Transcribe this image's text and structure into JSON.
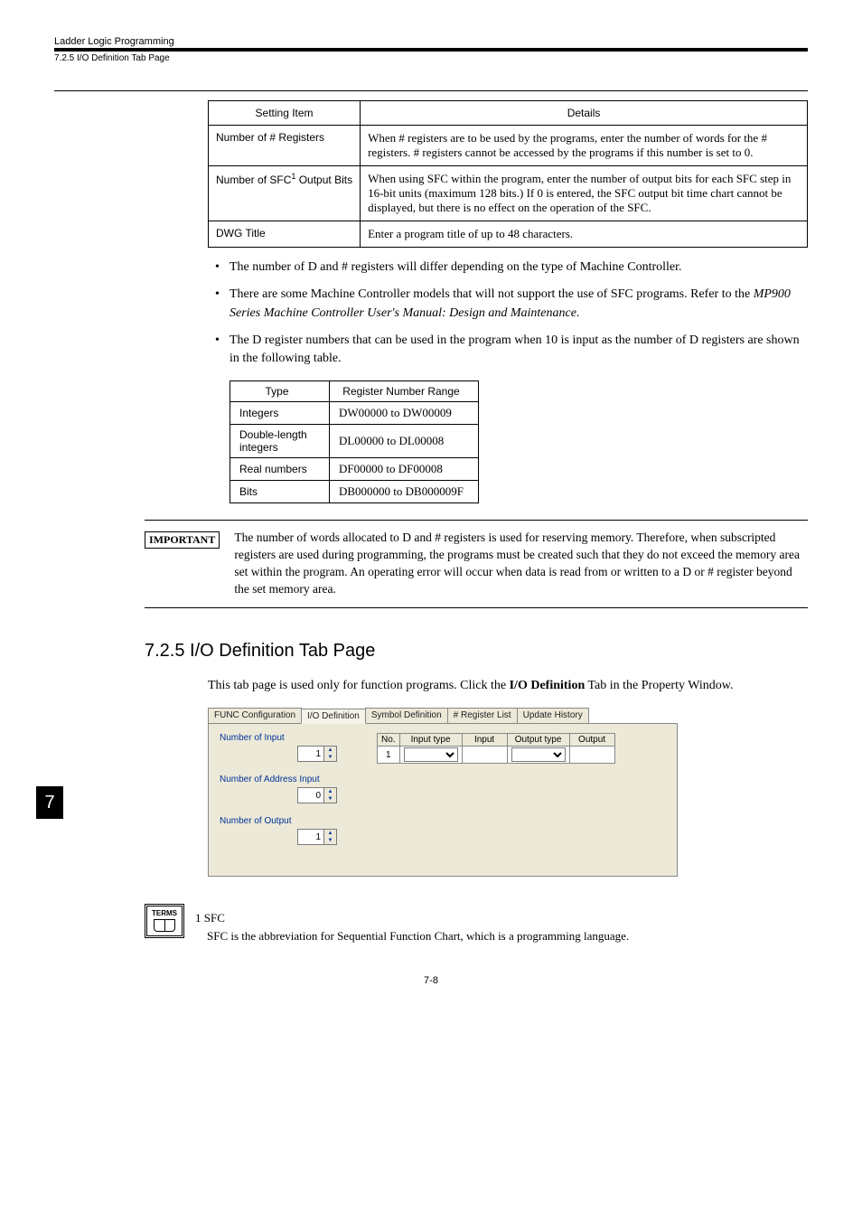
{
  "header": {
    "chapter": "Ladder Logic Programming",
    "section": "7.2.5  I/O Definition Tab Page"
  },
  "settingTable": {
    "headers": {
      "item": "Setting Item",
      "details": "Details"
    },
    "rows": [
      {
        "item": "Number of # Registers",
        "details": "When # registers are to be used by the programs, enter the number of words for the # registers. # registers cannot be accessed by the programs if this number is set to 0."
      },
      {
        "item_pre": "Number of SFC",
        "item_sup": "1",
        "item_post": " Output Bits",
        "details": "When using SFC within the program, enter the number of output bits for each SFC step in 16-bit units (maximum 128 bits.) If 0 is entered, the SFC output bit time chart cannot be displayed, but there is no effect on the operation of the SFC."
      },
      {
        "item": "DWG Title",
        "details": "Enter a program title of up to 48 characters."
      }
    ]
  },
  "bullets": [
    {
      "text": "The number of D and # registers will differ depending on the type of Machine Controller."
    },
    {
      "text_pre": "There are some Machine Controller models that will not support the use of SFC programs. Refer to the ",
      "italic": "MP900 Series Machine Controller User's Manual: Design and Maintenance",
      "text_post": "."
    },
    {
      "text": "The D register numbers that can be used in the program when 10 is input as the number of D registers are shown in the following table."
    }
  ],
  "regTable": {
    "headers": {
      "type": "Type",
      "range": "Register Number Range"
    },
    "rows": [
      {
        "type": "Integers",
        "range": "DW00000 to DW00009"
      },
      {
        "type": "Double-length integers",
        "range": "DL00000 to DL00008"
      },
      {
        "type": "Real numbers",
        "range": "DF00000 to DF00008"
      },
      {
        "type": "Bits",
        "range": "DB000000 to DB000009F"
      }
    ]
  },
  "important": {
    "tag": "IMPORTANT",
    "text": "The number of words allocated to D and # registers is used for reserving memory. Therefore, when subscripted registers are used during programming, the programs must be created such that they do not exceed the memory area set within the program. An operating error will occur when data is read from or written to a D or # register beyond the set memory area."
  },
  "sideTab": "7",
  "section725": {
    "heading": "7.2.5  I/O Definition Tab Page",
    "para_pre": "This tab page is used only for function programs. Click the ",
    "para_bold": "I/O Definition",
    "para_post": " Tab in the Property Window."
  },
  "funcPanel": {
    "tabs": [
      "FUNC Configuration",
      "I/O Definition",
      "Symbol Definition",
      "# Register List",
      "Update History"
    ],
    "activeTab": 1,
    "fields": {
      "input": {
        "label": "Number of Input",
        "value": "1"
      },
      "address": {
        "label": "Number of Address Input",
        "value": "0"
      },
      "output": {
        "label": "Number of Output",
        "value": "1"
      }
    },
    "miniHeaders": {
      "no": "No.",
      "inType": "Input type",
      "input": "Input",
      "outType": "Output type",
      "output": "Output"
    },
    "miniRow": {
      "no": "1"
    }
  },
  "terms": {
    "iconLabel": "TERMS",
    "num": "1 SFC",
    "text": "SFC is the abbreviation for Sequential Function Chart, which is a programming language."
  },
  "pageNum": "7-8"
}
